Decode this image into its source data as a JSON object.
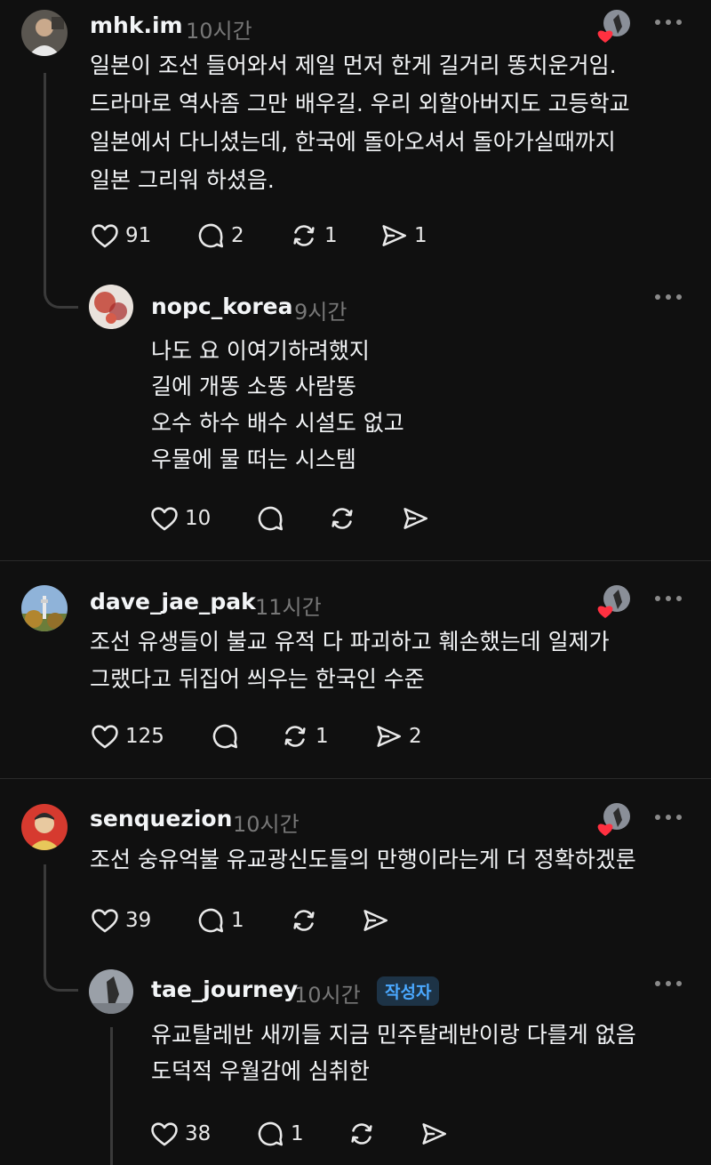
{
  "posts": [
    {
      "username": "mhk.im",
      "time": "10시간",
      "lines": [
        "일본이 조선 들어와서 제일 먼저 한게 길거리 똥치운거임.",
        "드라마로 역사좀 그만 배우길. 우리 외할아버지도 고등학교",
        "일본에서 다니셨는데, 한국에 돌아오셔서 돌아가실때까지",
        "일본 그리워 하셨음."
      ],
      "likes": "91",
      "replies": "2",
      "reposts": "1",
      "shares": "1",
      "avatar_icon": "profile-photo-icon"
    },
    {
      "username": "nopc_korea",
      "time": "9시간",
      "lines": [
        "나도 요 이여기하려했지",
        "길에 개똥 소똥 사람똥",
        "오수 하수 배수 시설도 없고",
        "우물에 물 떠는 시스템"
      ],
      "likes": "10",
      "replies": "",
      "reposts": "",
      "shares": "",
      "avatar_icon": "profile-photo-icon"
    },
    {
      "username": "dave_jae_pak",
      "time": "11시간",
      "lines": [
        "조선 유생들이 불교 유적 다 파괴하고 훼손했는데 일제가",
        "그랬다고 뒤집어 씌우는 한국인 수준"
      ],
      "likes": "125",
      "replies": "",
      "reposts": "1",
      "shares": "2",
      "avatar_icon": "profile-photo-icon"
    },
    {
      "username": "senquezion",
      "time": "10시간",
      "lines": [
        "조선 숭유억불 유교광신도들의 만행이라는게 더 정확하겠룬"
      ],
      "likes": "39",
      "replies": "1",
      "reposts": "",
      "shares": "",
      "avatar_icon": "profile-photo-icon"
    },
    {
      "username": "tae_journey",
      "time": "10시간",
      "badge": "작성자",
      "lines": [
        "유교탈레반 새끼들 지금 민주탈레반이랑 다를게 없음",
        "도덕적 우월감에 심취한"
      ],
      "likes": "38",
      "replies": "1",
      "reposts": "",
      "shares": "",
      "avatar_icon": "profile-photo-icon"
    }
  ],
  "colors": {
    "background": "#101010",
    "text": "#f3f5f7",
    "muted": "#777777",
    "heart": "#ff3040",
    "badge_text": "#4aa8ff"
  },
  "icons": [
    "heart-icon",
    "reply-icon",
    "repost-icon",
    "share-icon",
    "more-icon",
    "liked-by-author-icon"
  ]
}
